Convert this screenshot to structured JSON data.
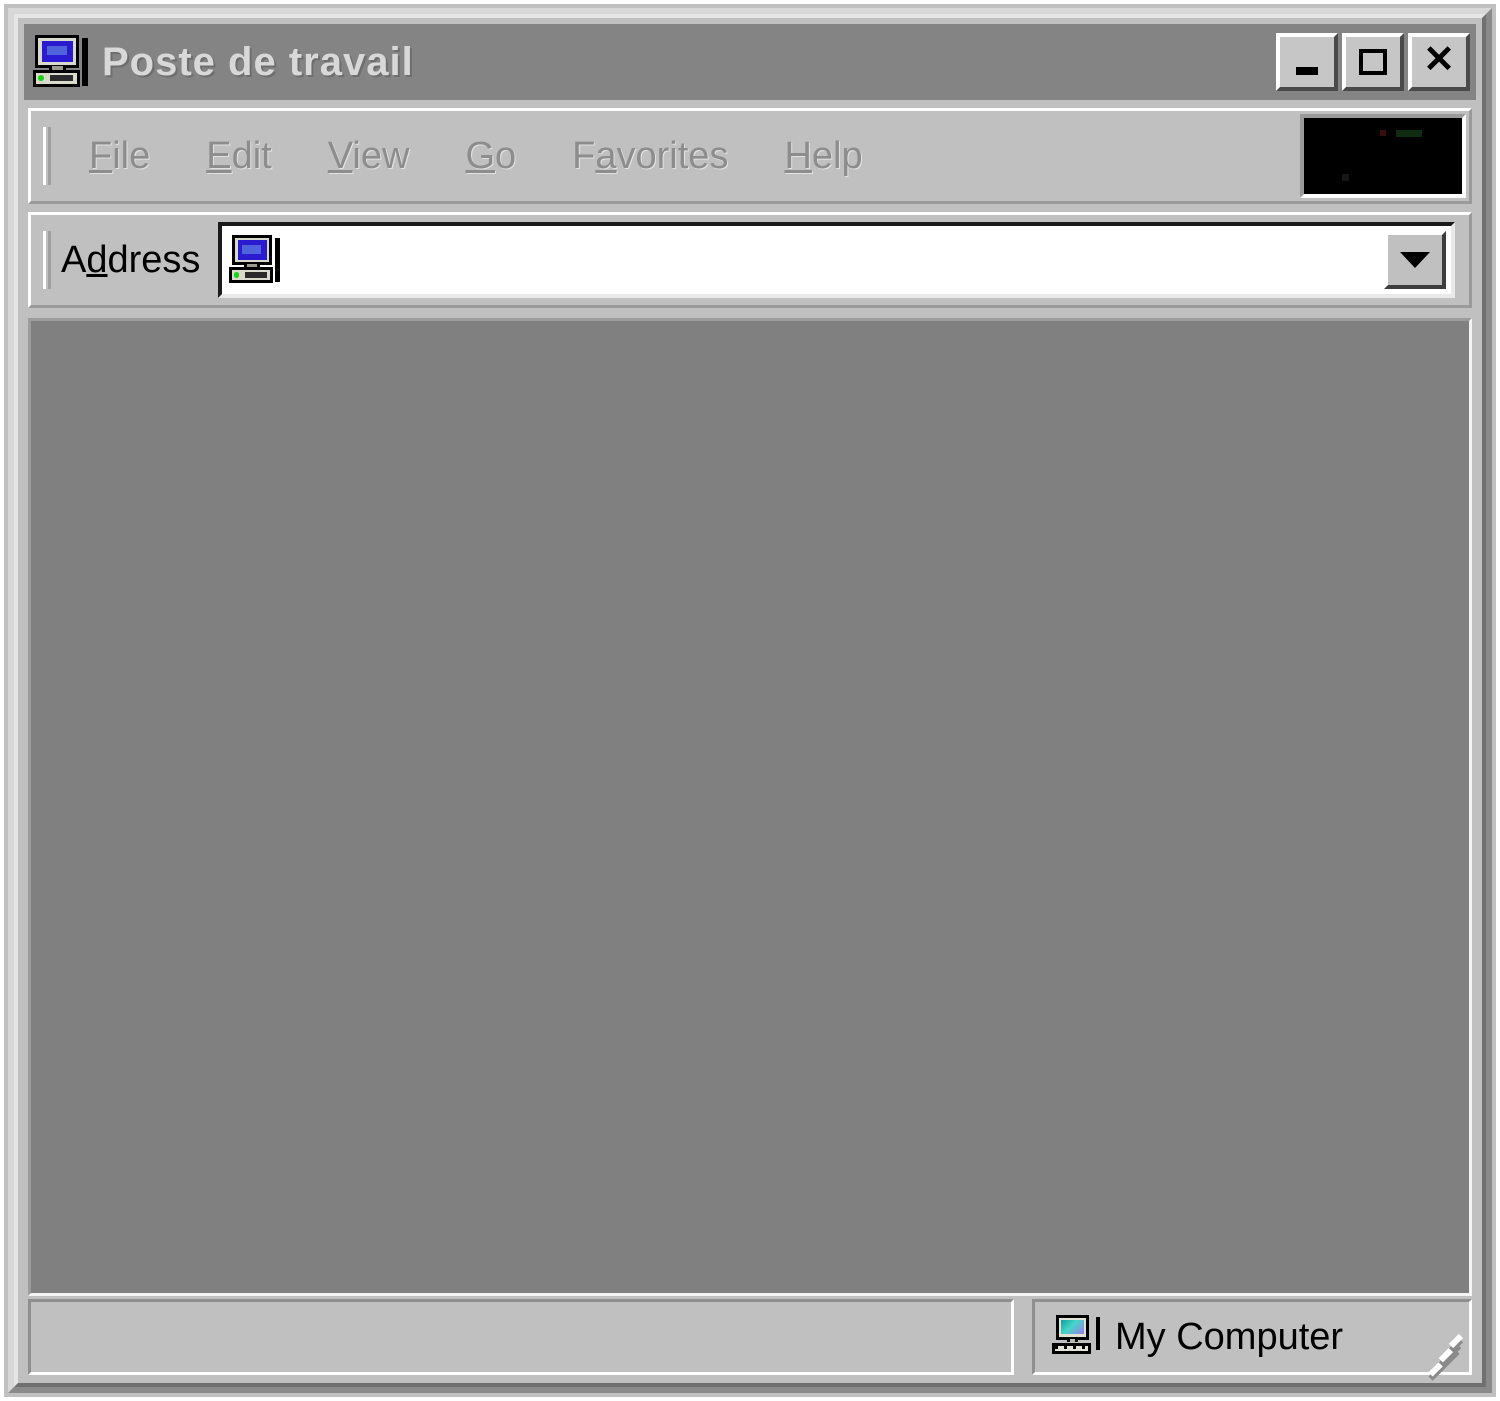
{
  "window": {
    "title": "Poste de travail",
    "title_icon": "my-computer-icon",
    "active": false,
    "controls": {
      "minimize_label": "_",
      "maximize_label": "□",
      "close_label": "×"
    }
  },
  "menubar": {
    "grip": "toolbar-grip",
    "items": [
      {
        "label": "File",
        "accel": "F",
        "pre": "",
        "post": "ile",
        "disabled": true
      },
      {
        "label": "Edit",
        "accel": "E",
        "pre": "",
        "post": "dit",
        "disabled": true
      },
      {
        "label": "View",
        "accel": "V",
        "pre": "",
        "post": "iew",
        "disabled": true
      },
      {
        "label": "Go",
        "accel": "G",
        "pre": "",
        "post": "o",
        "disabled": true
      },
      {
        "label": "Favorites",
        "accel": "a",
        "pre": "F",
        "post": "vorites",
        "disabled": true
      },
      {
        "label": "Help",
        "accel": "H",
        "pre": "",
        "post": "elp",
        "disabled": true
      }
    ],
    "logo_box": "animated-logo-box"
  },
  "addressbar": {
    "grip": "addressbar-grip",
    "label_pre": "A",
    "label_accel": "d",
    "label_post": "dress",
    "label_full": "Address",
    "icon": "my-computer-icon",
    "value": "",
    "placeholder": "",
    "dropdown_icon": "chevron-down-icon"
  },
  "client": {
    "background_color": "#808080",
    "items": []
  },
  "statusbar": {
    "left_text": "",
    "right_text": "My Computer",
    "right_icon": "my-computer-icon",
    "resize_grip": "resize-grip"
  },
  "colors": {
    "chrome": "#c0c0c0",
    "titlebar_inactive": "#848484",
    "titlebar_text": "#d8d8d8",
    "client_area": "#808080",
    "disabled_text": "#8d8d8d",
    "field_background": "#ffffff",
    "logo_background": "#000000"
  }
}
